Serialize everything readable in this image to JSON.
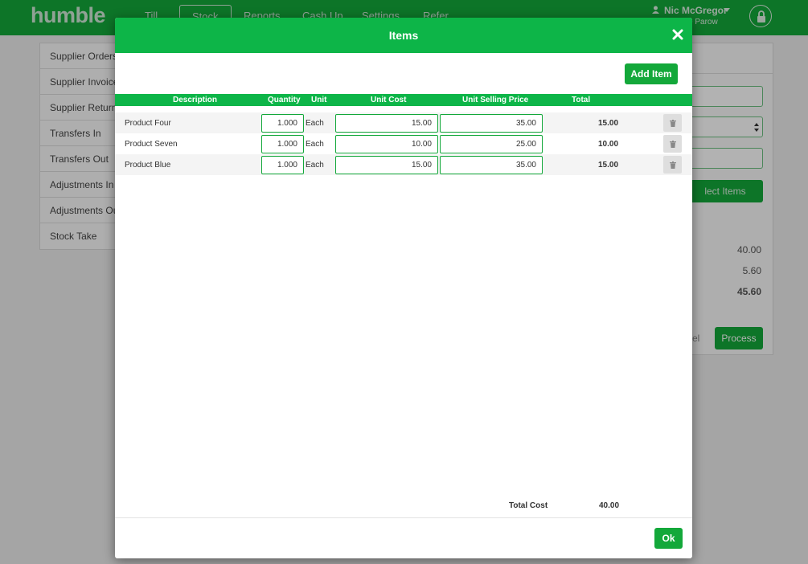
{
  "app": {
    "logo": "humble",
    "nav": [
      "Till",
      "Stock",
      "Reports",
      "Cash Up",
      "Settings",
      "Refer"
    ],
    "active_nav": "Stock",
    "user_name": "Nic McGregor",
    "user_location": "e Parow"
  },
  "sidebar": {
    "items": [
      "Supplier Orders",
      "Supplier Invoices",
      "Supplier Returns",
      "Transfers In",
      "Transfers Out",
      "Adjustments In",
      "Adjustments Out",
      "Stock Take"
    ]
  },
  "right_panel": {
    "select_items_label": "lect Items",
    "subtotal": "40.00",
    "tax": "5.60",
    "total": "45.60",
    "cancel_label": "cel",
    "process_label": "Process"
  },
  "modal": {
    "title": "Items",
    "add_item_label": "Add Item",
    "columns": {
      "description": "Description",
      "quantity": "Quantity",
      "unit": "Unit",
      "unit_cost": "Unit Cost",
      "unit_selling_price": "Unit Selling Price",
      "total": "Total"
    },
    "rows": [
      {
        "description": "Product Four",
        "quantity": "1.000",
        "unit": "Each",
        "unit_cost": "15.00",
        "unit_selling_price": "35.00",
        "total": "15.00"
      },
      {
        "description": "Product Seven",
        "quantity": "1.000",
        "unit": "Each",
        "unit_cost": "10.00",
        "unit_selling_price": "25.00",
        "total": "10.00"
      },
      {
        "description": "Product Blue",
        "quantity": "1.000",
        "unit": "Each",
        "unit_cost": "15.00",
        "unit_selling_price": "35.00",
        "total": "15.00"
      }
    ],
    "total_cost_label": "Total Cost",
    "total_cost": "40.00",
    "ok_label": "Ok"
  },
  "colors": {
    "brand_green": "#13a83a",
    "header_green": "#0db548"
  }
}
